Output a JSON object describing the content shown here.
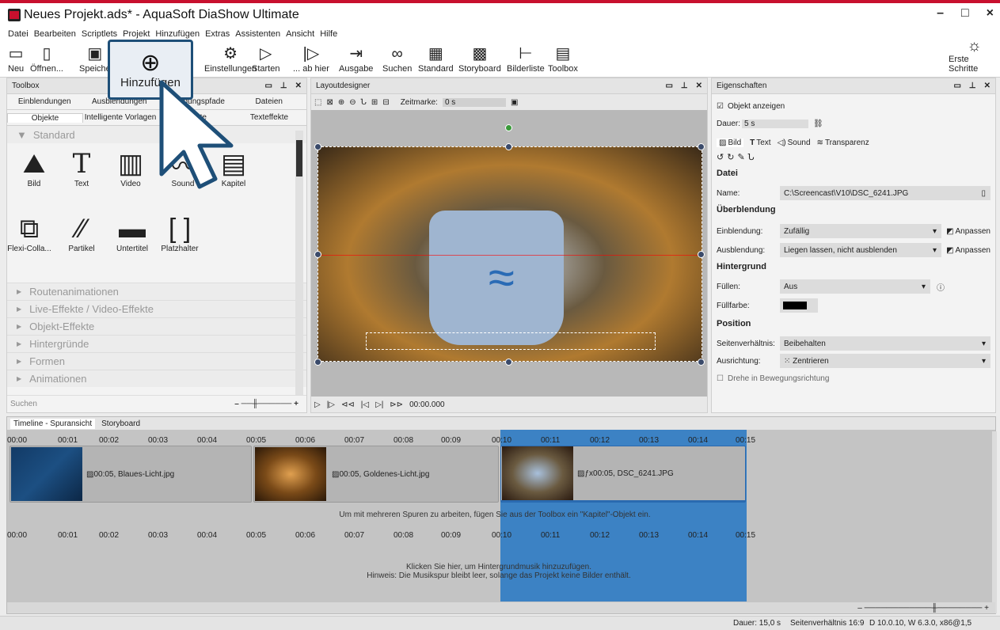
{
  "window": {
    "title": "Neues Projekt.ads* - AquaSoft DiaShow Ultimate",
    "controls": [
      "–",
      "□",
      "×"
    ]
  },
  "menu": [
    "Datei",
    "Bearbeiten",
    "Scriptlets",
    "Projekt",
    "Hinzufügen",
    "Extras",
    "Assistenten",
    "Ansicht",
    "Hilfe"
  ],
  "toolbar": {
    "new": "Neu",
    "open": "Öffnen...",
    "save": "Speiche",
    "add_label": "Hinzufügen",
    "k_label": "k",
    "settings": "Einstellungen",
    "start": "Starten",
    "from_here": "... ab hier",
    "output": "Ausgabe",
    "search": "Suchen",
    "standard": "Standard",
    "storyboard": "Storyboard",
    "image_list": "Bilderliste",
    "toolbox": "Toolbox",
    "first_steps": "Erste Schritte"
  },
  "toolbox": {
    "title": "Toolbox",
    "tabs1": [
      "Einblendungen",
      "Ausblendungen",
      "Bewegungspfade",
      "Dateien"
    ],
    "tabs2": [
      "Objekte",
      "Intelligente Vorlagen",
      "effekte",
      "Texteffekte"
    ],
    "section_standard": "Standard",
    "row1": [
      "Bild",
      "Text",
      "Video",
      "Sound",
      "Kapitel"
    ],
    "row2": [
      "Flexi-Colla...",
      "Partikel",
      "Untertitel",
      "Platzhalter"
    ],
    "sections": [
      "Routenanimationen",
      "Live-Effekte / Video-Effekte",
      "Objekt-Effekte",
      "Hintergründe",
      "Formen",
      "Animationen"
    ],
    "search": "Suchen"
  },
  "layout": {
    "title": "Layoutdesigner",
    "zeitmarke_label": "Zeitmarke:",
    "zeitmarke_value": "0 s",
    "time": "00:00.000"
  },
  "props": {
    "title": "Eigenschaften",
    "show_object": "Objekt anzeigen",
    "duration_label": "Dauer:",
    "duration": "5 s",
    "tabs": [
      "Bild",
      "Text",
      "Sound",
      "Transparenz"
    ],
    "datei": "Datei",
    "name_label": "Name:",
    "name_value": "C:\\Screencast\\V10\\DSC_6241.JPG",
    "ueberblendung": "Überblendung",
    "ein_label": "Einblendung:",
    "ein_value": "Zufällig",
    "anpassen": "Anpassen",
    "aus_label": "Ausblendung:",
    "aus_value": "Liegen lassen, nicht ausblenden",
    "hintergrund": "Hintergrund",
    "fuellen_label": "Füllen:",
    "fuellen_value": "Aus",
    "fuellfarbe_label": "Füllfarbe:",
    "position": "Position",
    "seiten_label": "Seitenverhältnis:",
    "seiten_value": "Beibehalten",
    "ausr_label": "Ausrichtung:",
    "ausr_value": "Zentrieren",
    "drehe": "Drehe in Bewegungsrichtung"
  },
  "timeline": {
    "tab1": "Timeline - Spuransicht",
    "tab2": "Storyboard",
    "ticks": [
      "00:00",
      "00:01",
      "00:02",
      "00:03",
      "00:04",
      "00:05",
      "00:06",
      "00:07",
      "00:08",
      "00:09",
      "00:10",
      "00:11",
      "00:12",
      "00:13",
      "00:14",
      "00:15"
    ],
    "clips": [
      "00:05, Blaues-Licht.jpg",
      "00:05, Goldenes-Licht.jpg",
      "00:05, DSC_6241.JPG"
    ],
    "hint": "Um mit mehreren Spuren zu arbeiten, fügen Sie aus der Toolbox ein \"Kapitel\"-Objekt ein.",
    "music1": "Klicken Sie hier, um Hintergrundmusik hinzuzufügen.",
    "music2": "Hinweis: Die Musikspur bleibt leer, solange das Projekt keine Bilder enthält."
  },
  "status": {
    "dauer": "Dauer: 15,0 s",
    "seiten": "Seitenverhältnis 16:9",
    "version": "D 10.0.10, W 6.3.0, x86@1,5"
  }
}
